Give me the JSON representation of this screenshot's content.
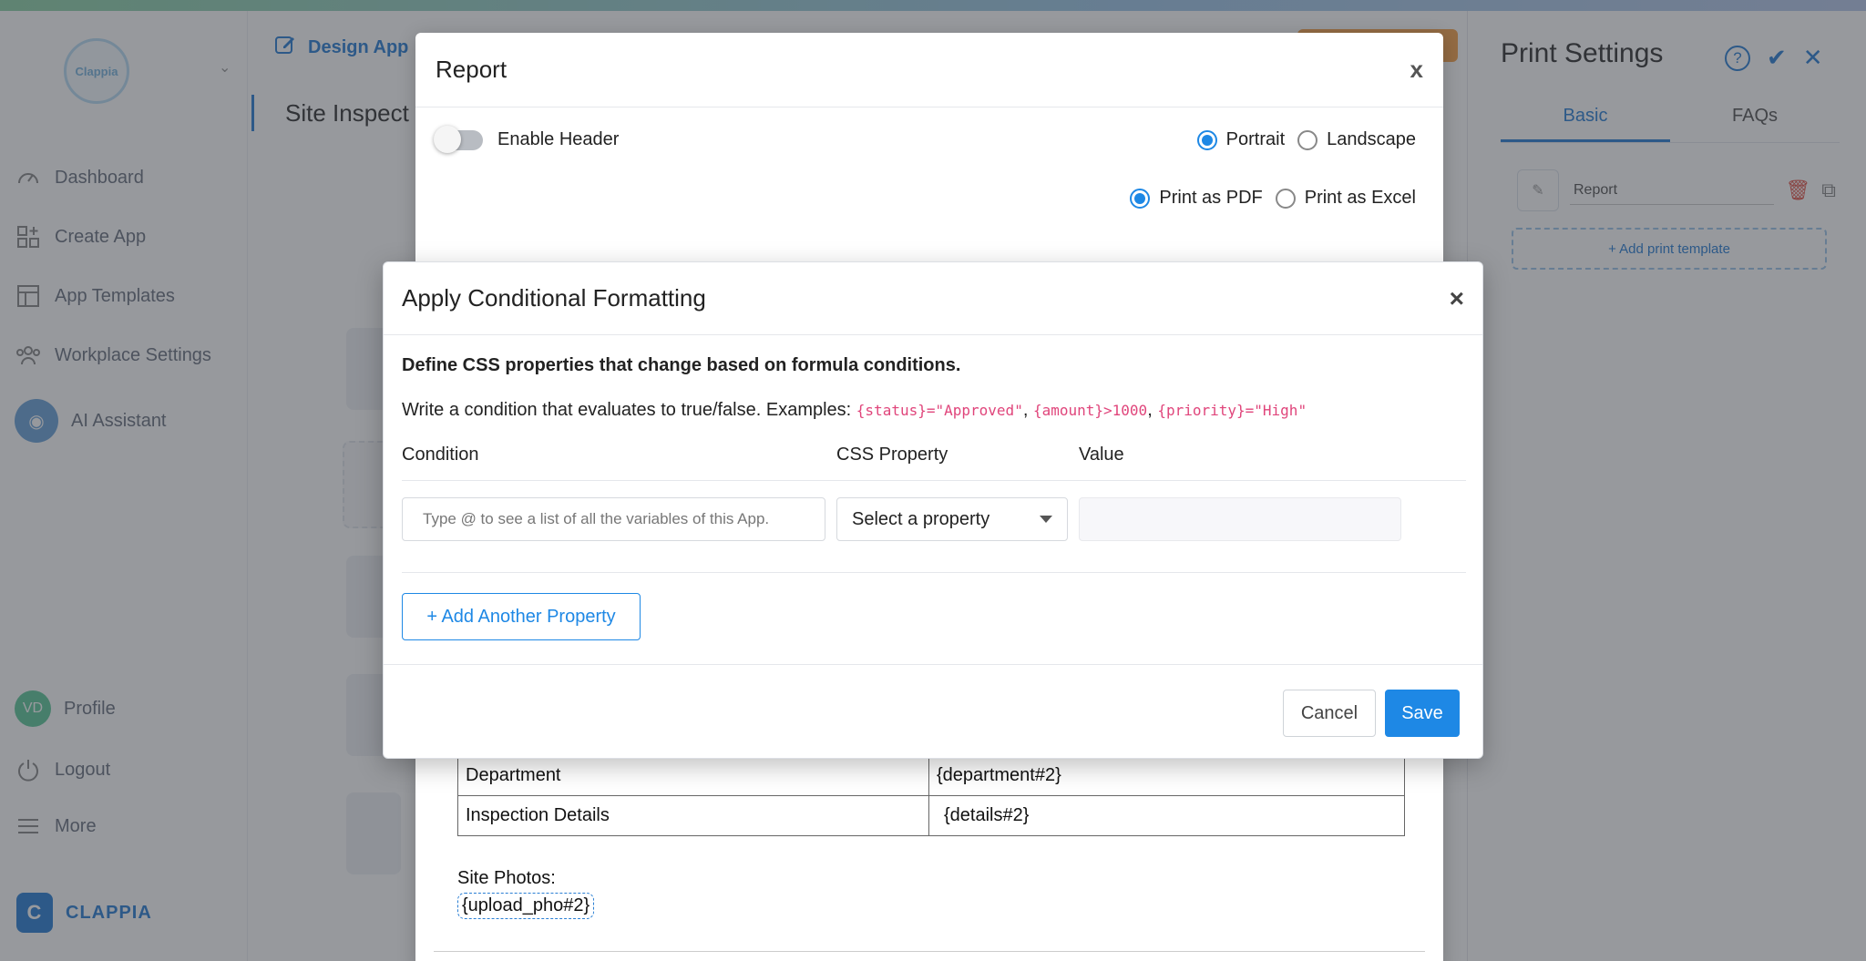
{
  "app": {
    "sidebar": {
      "logo_text": "Clappia",
      "nav": [
        {
          "label": "Dashboard",
          "icon": "dashboard-icon"
        },
        {
          "label": "Create App",
          "icon": "create-app-icon"
        },
        {
          "label": "App Templates",
          "icon": "templates-icon"
        },
        {
          "label": "Workplace Settings",
          "icon": "people-icon"
        },
        {
          "label": "AI Assistant",
          "icon": "ai-assistant-icon"
        }
      ],
      "profile": {
        "initials": "VD",
        "label": "Profile"
      },
      "logout_label": "Logout",
      "more_label": "More",
      "brand": "CLAPPIA",
      "brand_letter": "C"
    },
    "header": {
      "design_label": "Design App"
    },
    "page_title": "Site Inspect",
    "print_panel": {
      "title": "Print Settings",
      "tabs": [
        "Basic",
        "FAQs"
      ],
      "template_name": "Report",
      "add_template_label": "+ Add print template"
    }
  },
  "report_modal": {
    "title": "Report",
    "close_label": "x",
    "enable_header_label": "Enable Header",
    "orientation": {
      "options": [
        "Portrait",
        "Landscape"
      ],
      "selected": "Portrait"
    },
    "print_format": {
      "options": [
        "Print as PDF",
        "Print as Excel"
      ],
      "selected": "Print as PDF"
    },
    "table_rows": [
      {
        "label": "Department",
        "value": "{department#2}"
      },
      {
        "label": "Inspection Details",
        "value": "{details#2}"
      }
    ],
    "site_photos_label": "Site Photos:",
    "upload_tag": "{upload_pho#2}"
  },
  "cf_modal": {
    "title": "Apply Conditional Formatting",
    "close_label": "×",
    "description": "Define CSS properties that change based on formula conditions.",
    "hint_prefix": "Write a condition that evaluates to true/false. Examples:",
    "examples": [
      "{status}=\"Approved\"",
      "{amount}>1000",
      "{priority}=\"High\""
    ],
    "separator": ",",
    "columns": [
      "Condition",
      "CSS Property",
      "Value"
    ],
    "condition_placeholder": "Type @ to see a list of all the variables of this App.",
    "property_placeholder": "Select a property",
    "add_property_label": "+ Add Another Property",
    "cancel_label": "Cancel",
    "save_label": "Save"
  },
  "colors": {
    "accent": "#1e88e5",
    "code": "#e0457b",
    "overlay": "rgba(48,52,60,0.5)"
  }
}
